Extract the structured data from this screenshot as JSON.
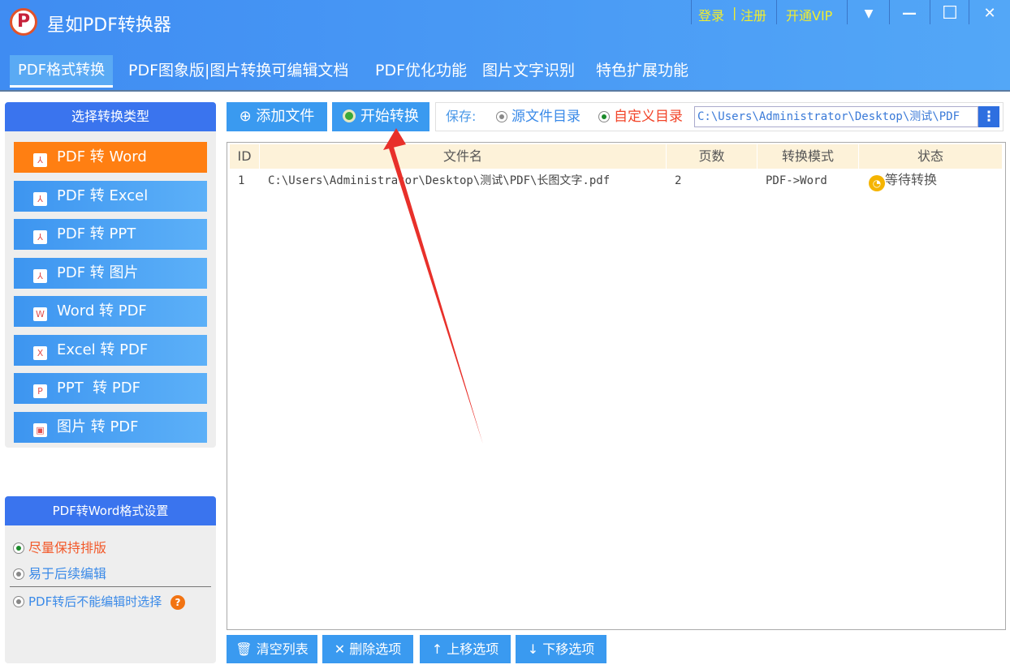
{
  "app": {
    "title": "星如PDF转换器",
    "login": "登录",
    "sep": "|",
    "register": "注册",
    "vip": "开通VIP",
    "menu_icon": "▼",
    "min_icon": "—",
    "max_icon": "☐",
    "close_icon": "✕"
  },
  "tabs": [
    {
      "label": "PDF格式转换"
    },
    {
      "label": "PDF图象版|图片转换可编辑文档"
    },
    {
      "label": "PDF优化功能"
    },
    {
      "label": "图片文字识别"
    },
    {
      "label": "特色扩展功能"
    }
  ],
  "sidebar": {
    "title": "选择转换类型",
    "items": [
      {
        "label": "PDF 转 Word",
        "icon": "pdf"
      },
      {
        "label": "PDF 转 Excel",
        "icon": "pdf"
      },
      {
        "label": "PDF 转 PPT",
        "icon": "pdf"
      },
      {
        "label": "PDF 转 图片",
        "icon": "pdf"
      },
      {
        "label": "Word 转 PDF",
        "icon": "W"
      },
      {
        "label": "Excel 转 PDF",
        "icon": "X"
      },
      {
        "label": "PPT  转 PDF",
        "icon": "P"
      },
      {
        "label": "图片 转 PDF",
        "icon": "img"
      }
    ]
  },
  "settings": {
    "title": "PDF转Word格式设置",
    "options": [
      "尽量保持排版",
      "易于后续编辑",
      "PDF转后不能编辑时选择"
    ],
    "help": "?"
  },
  "toolbar": {
    "add": "添加文件",
    "start": "开始转换",
    "save_label": "保存:",
    "opt_source": "源文件目录",
    "opt_custom": "自定义目录",
    "path": "C:\\Users\\Administrator\\Desktop\\测试\\PDF",
    "more": "⋮"
  },
  "table": {
    "headers": [
      "ID",
      "文件名",
      "页数",
      "转换模式",
      "状态"
    ],
    "rows": [
      {
        "id": "1",
        "file": "C:\\Users\\Administrator\\Desktop\\测试\\PDF\\长图文字.pdf",
        "pages": "2",
        "mode": "PDF->Word",
        "status": "等待转换"
      }
    ]
  },
  "bottom": {
    "clear": "清空列表",
    "delete": "删除选项",
    "up": "上移选项",
    "down": "下移选项"
  },
  "colors": {
    "accent": "#3a9af0",
    "active": "#ff7f12",
    "status": "#f5b400"
  }
}
